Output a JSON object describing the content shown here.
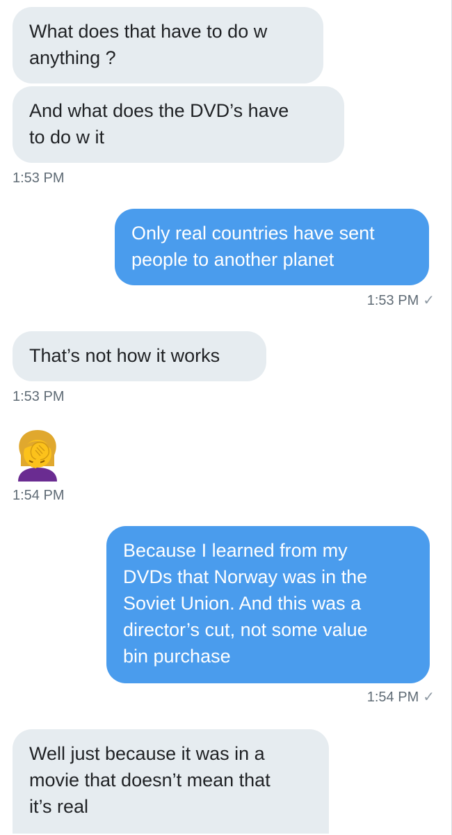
{
  "conversation": {
    "messages": [
      {
        "direction": "received",
        "text": "What does that have to do w\nanything ?"
      },
      {
        "direction": "received",
        "text": "And what does the DVD’s have\nto do w it",
        "time": "1:53 PM"
      },
      {
        "direction": "sent",
        "text": "Only real countries have sent\npeople to another planet",
        "time": "1:53 PM",
        "receipt": "✓"
      },
      {
        "direction": "received",
        "text": "That’s not how it works",
        "time": "1:53 PM"
      },
      {
        "direction": "received",
        "emoji": "face-palm-woman-icon",
        "time": "1:54 PM"
      },
      {
        "direction": "sent",
        "text": "Because I learned from my\nDVDs that Norway was in the\nSoviet Union. And this was a\ndirector’s cut, not some value\nbin purchase",
        "time": "1:54 PM",
        "receipt": "✓"
      },
      {
        "direction": "received",
        "text": "Well just because it was in a\nmovie that doesn’t mean that\nit’s real"
      }
    ]
  },
  "colors": {
    "received_bubble": "#e6ecf0",
    "sent_bubble": "#4a9ced",
    "timestamp": "#5f6b75"
  }
}
